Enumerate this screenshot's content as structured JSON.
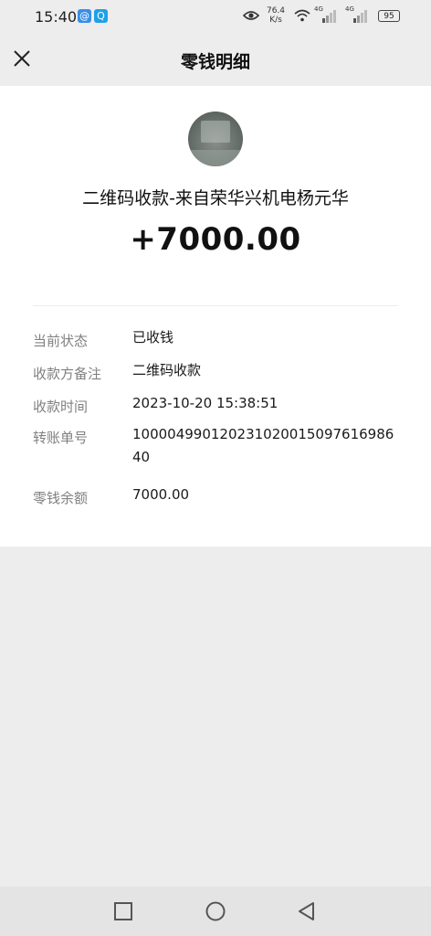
{
  "status_bar": {
    "time": "15:40",
    "app_badge_1": "@",
    "app_badge_2": "Q",
    "net_speed_value": "76.4",
    "net_speed_unit": "K/s",
    "signal_1_label": "4G",
    "signal_2_label": "4G",
    "battery": "95"
  },
  "header": {
    "title": "零钱明细"
  },
  "transaction": {
    "title": "二维码收款-来自荣华兴机电杨元华",
    "amount": "+7000.00",
    "details": [
      {
        "label": "当前状态",
        "value": "已收钱"
      },
      {
        "label": "收款方备注",
        "value": "二维码收款"
      },
      {
        "label": "收款时间",
        "value": "2023-10-20 15:38:51"
      },
      {
        "label": "转账单号",
        "value": "10000499012023102001509761698640"
      },
      {
        "label": "零钱余额",
        "value": "7000.00"
      }
    ]
  },
  "icons": {
    "close": "close-icon",
    "eye": "eye-icon",
    "wifi": "wifi-icon",
    "nav_recent": "square-icon",
    "nav_home": "circle-icon",
    "nav_back": "triangle-back-icon"
  }
}
